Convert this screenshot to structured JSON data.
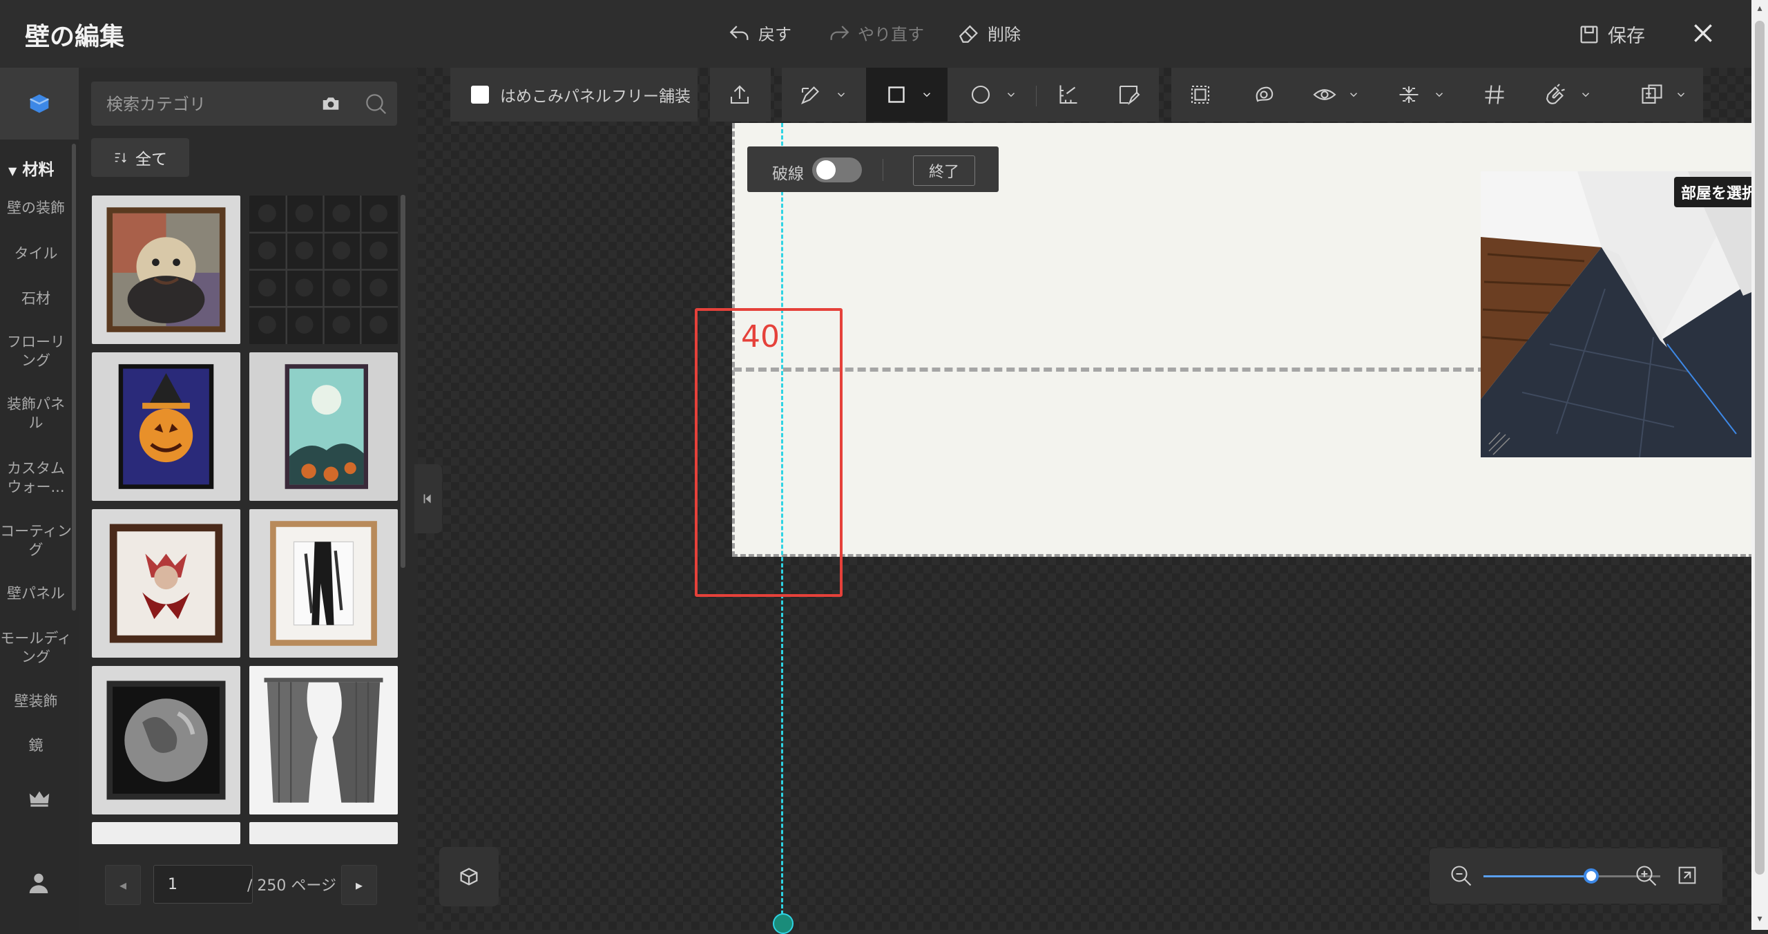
{
  "header": {
    "title": "壁の編集",
    "undo_label": "戻す",
    "redo_label": "やり直す",
    "delete_label": "削除",
    "save_label": "保存"
  },
  "sidebar": {
    "section_title": "材料",
    "categories": [
      {
        "label": "壁の装飾"
      },
      {
        "label": "タイル"
      },
      {
        "label": "石材"
      },
      {
        "label": "フローリング"
      },
      {
        "label": "装飾パネル"
      },
      {
        "label": "カスタムウォー..."
      },
      {
        "label": "コーティング"
      },
      {
        "label": "壁パネル"
      },
      {
        "label": "モールディング"
      },
      {
        "label": "壁装飾"
      },
      {
        "label": "鏡"
      }
    ]
  },
  "panel": {
    "search_placeholder": "検索カテゴリ",
    "filter_label": "全て",
    "materials": [
      {
        "name": "portrait-painting"
      },
      {
        "name": "black-tile-pattern"
      },
      {
        "name": "pumpkin-painting"
      },
      {
        "name": "halloween-night-painting"
      },
      {
        "name": "creature-painting"
      },
      {
        "name": "ink-tree-painting"
      },
      {
        "name": "earth-painting"
      },
      {
        "name": "curtain"
      }
    ],
    "pagination": {
      "current_page": "1",
      "total_label": "/ 250 ページ"
    }
  },
  "toolbar": {
    "paving_label": "はめこみパネルフリー舗装"
  },
  "dash_popup": {
    "label": "破線",
    "end_label": "終了",
    "dashed_enabled": false
  },
  "canvas": {
    "dimension_label": "40"
  },
  "preview": {
    "room_select_label": "部屋を選択"
  },
  "zoom": {
    "level_fraction": 0.61
  },
  "colors": {
    "accent": "#3d88e6",
    "guide": "#2ed3e3",
    "dimension": "#e5413a"
  }
}
